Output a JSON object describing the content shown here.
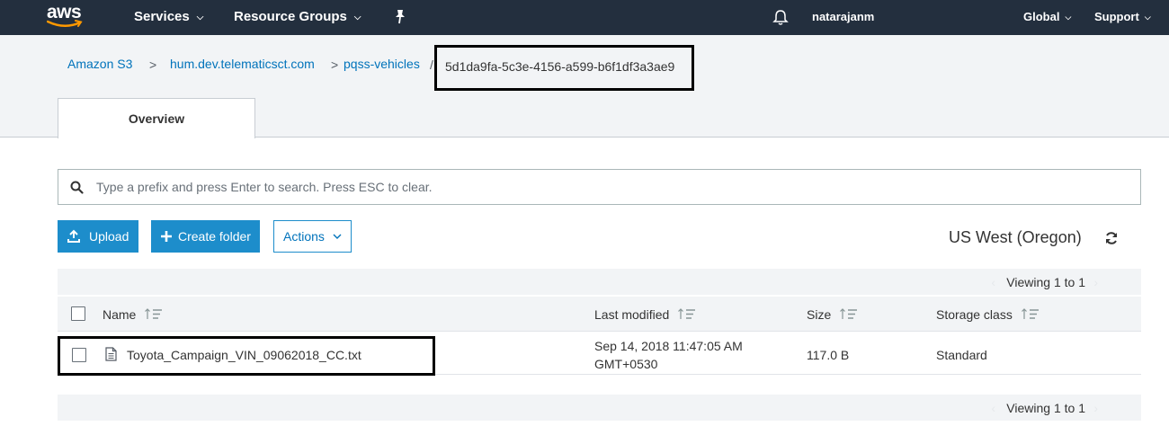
{
  "nav": {
    "logo_text": "aws",
    "services": "Services",
    "resource_groups": "Resource Groups",
    "user": "natarajanm",
    "region_menu": "Global",
    "support": "Support"
  },
  "breadcrumb": {
    "items": [
      "Amazon S3",
      "hum.dev.telematicsct.com",
      "pqss-vehicles"
    ],
    "separator": ">",
    "current_separator": "/",
    "current": "5d1da9fa-5c3e-4156-a599-b6f1df3a3ae9"
  },
  "tabs": {
    "overview": "Overview"
  },
  "search": {
    "placeholder": "Type a prefix and press Enter to search. Press ESC to clear.",
    "value": ""
  },
  "toolbar": {
    "upload": "Upload",
    "create_folder": "Create folder",
    "actions": "Actions",
    "region": "US West (Oregon)"
  },
  "table": {
    "viewing_top": "Viewing 1 to 1",
    "viewing_bottom": "Viewing 1 to 1",
    "columns": [
      "Name",
      "Last modified",
      "Size",
      "Storage class"
    ],
    "rows": [
      {
        "name": "Toyota_Campaign_VIN_09062018_CC.txt",
        "last_modified_line1": "Sep 14, 2018 11:47:05 AM",
        "last_modified_line2": "GMT+0530",
        "size": "117.0 B",
        "storage_class": "Standard"
      }
    ]
  },
  "colors": {
    "nav_bg": "#232f3e",
    "accent": "#1d8dcb",
    "link": "#0073bb",
    "aws_orange": "#ff9900"
  }
}
